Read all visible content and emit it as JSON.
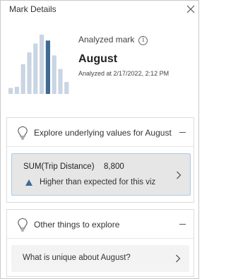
{
  "header": {
    "title": "Mark Details"
  },
  "mark": {
    "label": "Analyzed mark",
    "info_glyph": "i",
    "name": "August",
    "analyzed_at": "Analyzed at 2/17/2022, 2:12 PM"
  },
  "thumbnail": {
    "bar_levels": [
      0.1,
      0.12,
      0.5,
      0.7,
      0.85,
      1.0,
      0.9,
      0.65,
      0.42,
      0.2
    ],
    "highlight_index": 6,
    "colors": {
      "bar": "#c9d5e2",
      "highlight": "#3f6a93"
    }
  },
  "sections": {
    "explore_values": {
      "title": "Explore underlying values for August",
      "card": {
        "measure": "SUM(Trip Distance)",
        "value": "8,800",
        "description": "Higher than expected for this viz"
      }
    },
    "other_things": {
      "title": "Other things to explore",
      "card": {
        "text": "What is unique about August?"
      }
    }
  },
  "colors": {
    "accent": "#3e6b96",
    "card_bg": "#e6e6e6",
    "card_border": "#a9cbe6"
  }
}
